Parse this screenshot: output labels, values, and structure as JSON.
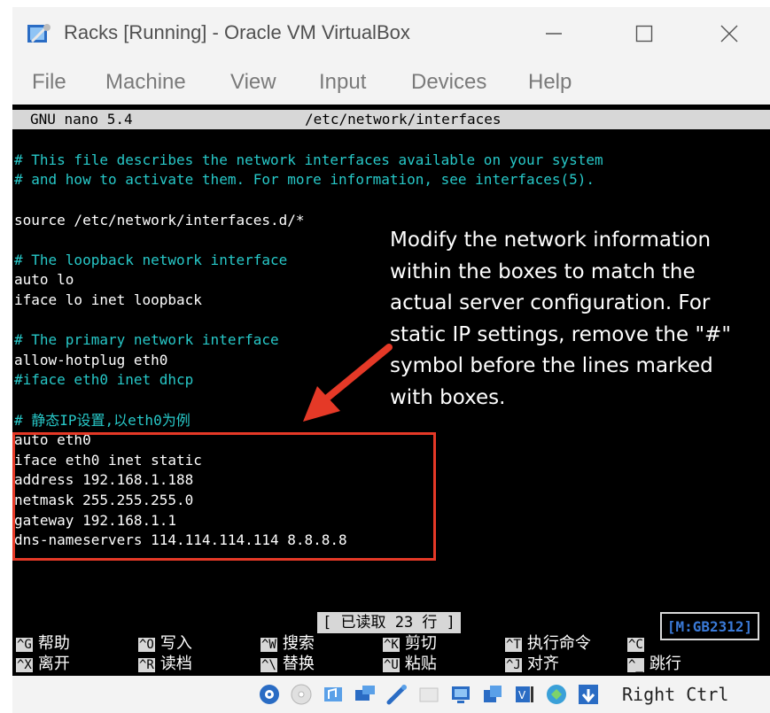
{
  "window": {
    "title": "Racks [Running] - Oracle VM VirtualBox",
    "menu": [
      "File",
      "Machine",
      "View",
      "Input",
      "Devices",
      "Help"
    ]
  },
  "nano": {
    "version": "GNU nano 5.4",
    "filename": "/etc/network/interfaces",
    "lines": [
      {
        "text": "# This file describes the network interfaces available on your system",
        "type": "comment"
      },
      {
        "text": "# and how to activate them. For more information, see interfaces(5).",
        "type": "comment"
      },
      {
        "text": "",
        "type": "plain"
      },
      {
        "text": "source /etc/network/interfaces.d/*",
        "type": "plain"
      },
      {
        "text": "",
        "type": "plain"
      },
      {
        "text": "# The loopback network interface",
        "type": "comment"
      },
      {
        "text": "auto lo",
        "type": "plain"
      },
      {
        "text": "iface lo inet loopback",
        "type": "plain"
      },
      {
        "text": "",
        "type": "plain"
      },
      {
        "text": "# The primary network interface",
        "type": "comment"
      },
      {
        "text": "allow-hotplug eth0",
        "type": "plain"
      },
      {
        "text": "#iface eth0 inet dhcp",
        "type": "comment"
      },
      {
        "text": "",
        "type": "plain"
      },
      {
        "text": "# 静态IP设置,以eth0为例",
        "type": "comment"
      },
      {
        "text": "auto eth0",
        "type": "plain"
      },
      {
        "text": "iface eth0 inet static",
        "type": "plain"
      },
      {
        "text": "address 192.168.1.188",
        "type": "plain"
      },
      {
        "text": "netmask 255.255.255.0",
        "type": "plain"
      },
      {
        "text": "gateway 192.168.1.1",
        "type": "plain"
      },
      {
        "text": "dns-nameservers 114.114.114.114 8.8.8.8",
        "type": "plain"
      }
    ],
    "status": "[ 已读取 23 行 ]",
    "encoding": "[M:GB2312]",
    "shortcuts": [
      {
        "key": "^G",
        "label": "帮助"
      },
      {
        "key": "^X",
        "label": "离开"
      },
      {
        "key": "^O",
        "label": "写入"
      },
      {
        "key": "^R",
        "label": "读档"
      },
      {
        "key": "^W",
        "label": "搜索"
      },
      {
        "key": "^\\",
        "label": "替换"
      },
      {
        "key": "^K",
        "label": "剪切"
      },
      {
        "key": "^U",
        "label": "粘贴"
      },
      {
        "key": "^T",
        "label": "执行命令"
      },
      {
        "key": "^J",
        "label": "对齐"
      },
      {
        "key": "^C",
        "label": ""
      },
      {
        "key": "^_",
        "label": "跳行"
      }
    ]
  },
  "annotation": {
    "text": "Modify the network information within the boxes to match the actual server configuration. For static IP settings, remove the \"#\" symbol before the lines marked with boxes."
  },
  "statusbar": {
    "icons": [
      "hard-disk-icon",
      "optical-drive-icon",
      "audio-icon",
      "network-icon",
      "usb-icon",
      "shared-folder-icon",
      "display-icon",
      "video-capture-icon",
      "cpu-icon",
      "mouse-integration-icon",
      "keyboard-icon"
    ],
    "host_key": "Right Ctrl"
  },
  "colors": {
    "comment": "#27c8c8",
    "highlight_border": "#e53927",
    "encoding_text": "#3a7ad8"
  }
}
